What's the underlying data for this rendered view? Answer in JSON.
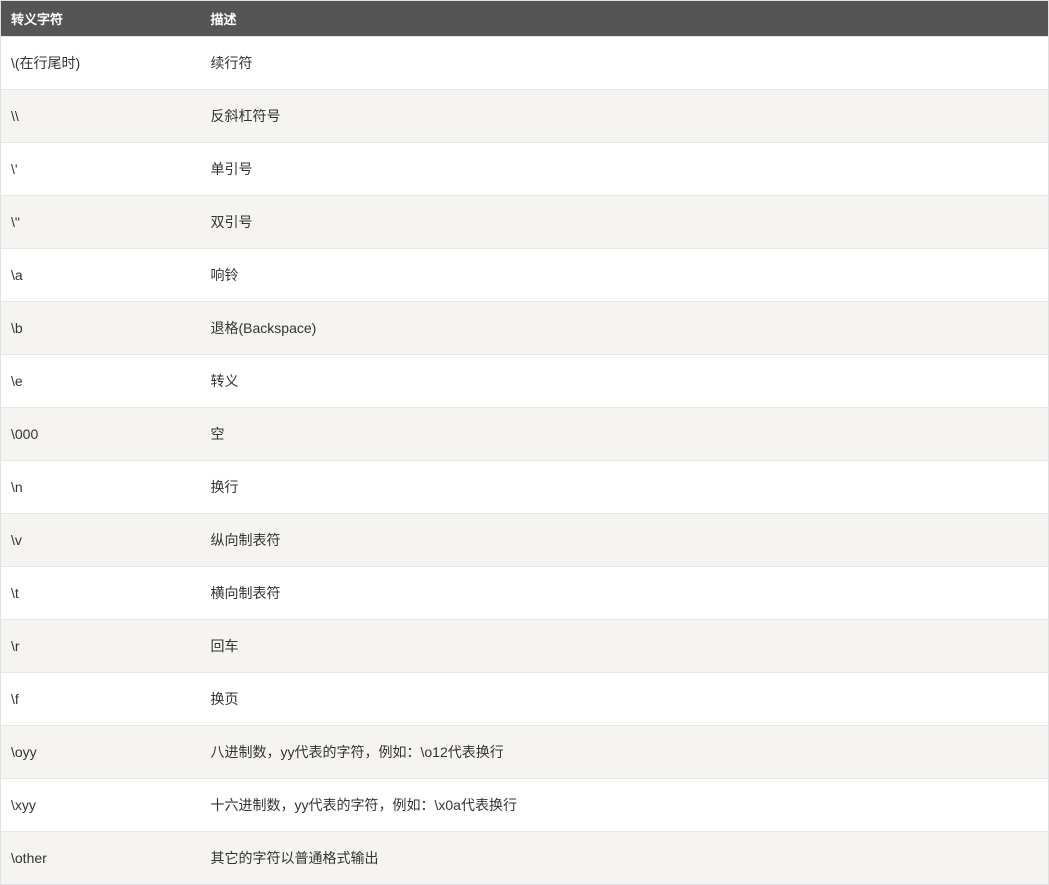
{
  "table": {
    "headers": [
      "转义字符",
      "描述"
    ],
    "rows": [
      {
        "escape": "\\(在行尾时)",
        "desc": "续行符"
      },
      {
        "escape": "\\\\",
        "desc": "反斜杠符号"
      },
      {
        "escape": "\\'",
        "desc": "单引号"
      },
      {
        "escape": "\\\"",
        "desc": "双引号"
      },
      {
        "escape": "\\a",
        "desc": "响铃"
      },
      {
        "escape": "\\b",
        "desc": "退格(Backspace)"
      },
      {
        "escape": "\\e",
        "desc": "转义"
      },
      {
        "escape": "\\000",
        "desc": "空"
      },
      {
        "escape": "\\n",
        "desc": "换行"
      },
      {
        "escape": "\\v",
        "desc": "纵向制表符"
      },
      {
        "escape": "\\t",
        "desc": "横向制表符"
      },
      {
        "escape": "\\r",
        "desc": "回车"
      },
      {
        "escape": "\\f",
        "desc": "换页"
      },
      {
        "escape": "\\oyy",
        "desc": "八进制数，yy代表的字符，例如：\\o12代表换行"
      },
      {
        "escape": "\\xyy",
        "desc": "十六进制数，yy代表的字符，例如：\\x0a代表换行"
      },
      {
        "escape": "\\other",
        "desc": "其它的字符以普通格式输出"
      }
    ]
  }
}
